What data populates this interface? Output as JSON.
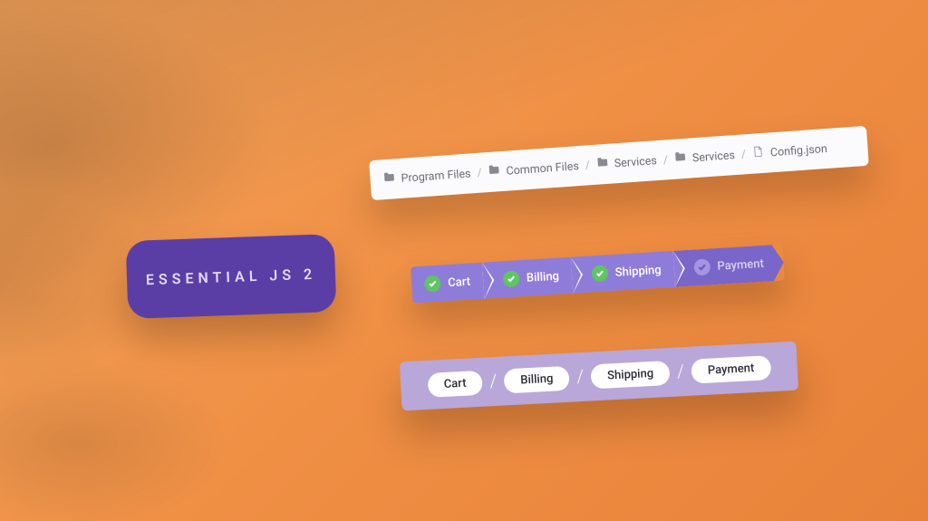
{
  "badge": {
    "label": "ESSENTIAL JS 2"
  },
  "path": {
    "items": [
      {
        "label": "Program Files",
        "icon": "folder-icon",
        "type": "folder"
      },
      {
        "label": "Common Files",
        "icon": "folder-icon",
        "type": "folder"
      },
      {
        "label": "Services",
        "icon": "folder-icon",
        "type": "folder"
      },
      {
        "label": "Services",
        "icon": "folder-icon",
        "type": "folder"
      },
      {
        "label": "Config.json",
        "icon": "file-icon",
        "type": "file"
      }
    ],
    "separator": "/"
  },
  "stepper": {
    "steps": [
      {
        "label": "Cart",
        "status": "complete"
      },
      {
        "label": "Billing",
        "status": "complete"
      },
      {
        "label": "Shipping",
        "status": "complete"
      },
      {
        "label": "Payment",
        "status": "pending"
      }
    ]
  },
  "pills": {
    "items": [
      {
        "label": "Cart"
      },
      {
        "label": "Billing"
      },
      {
        "label": "Shipping"
      },
      {
        "label": "Payment"
      }
    ],
    "separator": "/"
  },
  "colors": {
    "badge_bg": "#5b3ea5",
    "stepper_bg": "#8e7cd9",
    "stepper_current_bg": "#7a66c8",
    "check_bg": "#5fc563",
    "pill_bar_bg": "#b8a7d8"
  }
}
